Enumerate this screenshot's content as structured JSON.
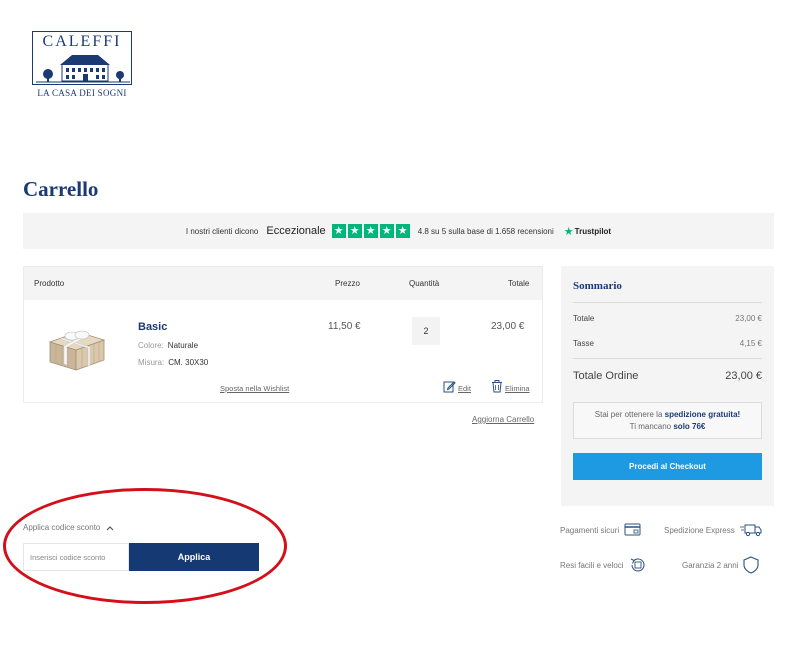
{
  "brand": {
    "name": "CALEFFI",
    "tagline": "LA CASA DEI SOGNI"
  },
  "page": {
    "title": "Carrello"
  },
  "trust": {
    "intro": "I nostri clienti dicono",
    "rating_word": "Eccezionale",
    "stars": 5,
    "score_text": "4.8 su 5 sulla base di 1.658 recensioni",
    "provider": "Trustpilot"
  },
  "cart": {
    "headers": {
      "product": "Prodotto",
      "price": "Prezzo",
      "quantity": "Quantità",
      "total": "Totale"
    },
    "item": {
      "name": "Basic",
      "color_label": "Colore:",
      "color_value": "Naturale",
      "size_label": "Misura:",
      "size_value": "CM. 30X30",
      "price": "11,50 €",
      "quantity": "2",
      "total": "23,00 €",
      "wishlist_link": "Sposta nella Wishlist",
      "edit_link": "Edit",
      "remove_link": "Elimina"
    },
    "update_link": "Aggiorna Carrello"
  },
  "summary": {
    "title": "Sommario",
    "subtotal_label": "Totale",
    "subtotal_value": "23,00 €",
    "tax_label": "Tasse",
    "tax_value": "4,15 €",
    "order_total_label": "Totale Ordine",
    "order_total_value": "23,00 €",
    "shipping_msg_1": "Stai per ottenere la",
    "shipping_msg_bold": "spedizione gratuita!",
    "shipping_msg_2": "Ti mancano",
    "shipping_msg_amount": "solo 76€",
    "checkout_label": "Procedi al Checkout"
  },
  "discount": {
    "toggle_label": "Applica codice sconto",
    "input_placeholder": "Inserisci codice sconto",
    "apply_label": "Applica"
  },
  "features": {
    "secure_payments": "Pagamenti sicuri",
    "express_shipping": "Spedizione Express",
    "easy_returns": "Resi facili e veloci",
    "warranty": "Garanzia 2 anni"
  },
  "colors": {
    "brand_navy": "#1b3a73",
    "checkout_blue": "#1e9ae3",
    "trustpilot_green": "#00b67a",
    "highlight_red": "#d40f1a"
  }
}
